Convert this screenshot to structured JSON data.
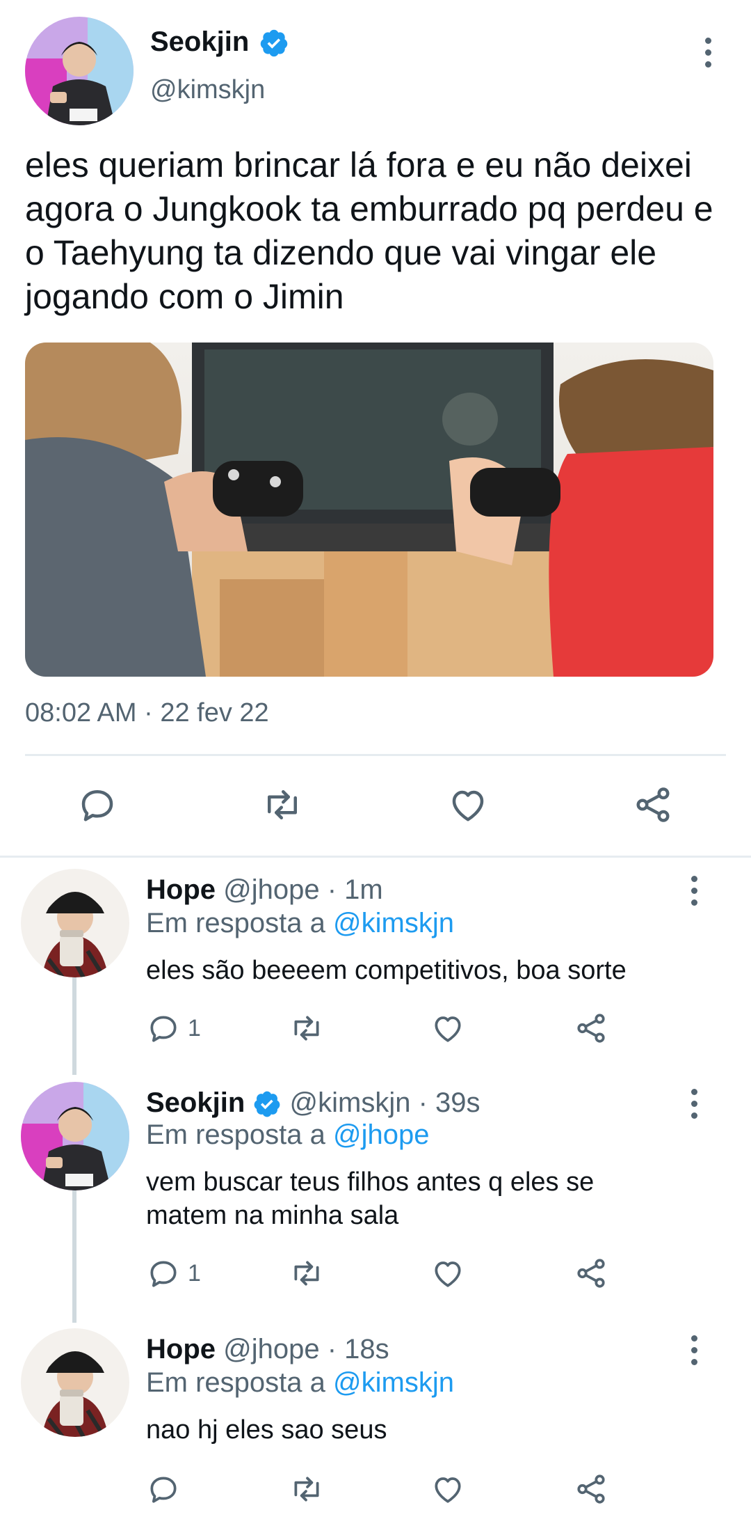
{
  "main_tweet": {
    "author_name": "Seokjin",
    "author_handle": "@kimskjn",
    "verified": true,
    "text": "eles queriam brincar lá fora e eu não deixei agora o Jungkook ta emburrado pq perdeu e o Taehyung ta dizendo que vai vingar ele jogando com o Jimin",
    "timestamp": "08:02 AM · 22 fev 22",
    "actions": [
      "reply-icon",
      "retweet-icon",
      "like-icon",
      "share-icon"
    ]
  },
  "replies": [
    {
      "author_name": "Hope",
      "author_handle": "@jhope",
      "time": "· 1m",
      "replying_label": "Em resposta a",
      "replying_to": "@kimskjn",
      "text": "eles são beeeem competitivos, boa sorte",
      "reply_count": "1"
    },
    {
      "author_name": "Seokjin",
      "author_handle": "@kimskjn",
      "verified": true,
      "time": "· 39s",
      "replying_label": "Em resposta a",
      "replying_to": "@jhope",
      "text": "vem buscar teus filhos antes q eles se matem na minha sala",
      "reply_count": "1"
    },
    {
      "author_name": "Hope",
      "author_handle": "@jhope",
      "time": "· 18s",
      "replying_label": "Em resposta a",
      "replying_to": "@kimskjn",
      "text": "nao hj eles sao seus",
      "reply_count": ""
    }
  ],
  "colors": {
    "accent": "#1d9bf0",
    "secondary_text": "#536471",
    "primary_text": "#0f1419"
  }
}
